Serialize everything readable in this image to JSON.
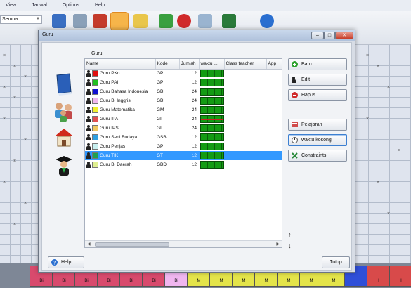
{
  "app": {
    "menu": [
      "View",
      "Jadwal",
      "Options",
      "Help"
    ],
    "filter_value": "Semua",
    "toolbar_icons": [
      "book-icon",
      "people-icon",
      "house-icon",
      "teacher-icon",
      "folder-icon",
      "save-icon",
      "stop-icon",
      "key-icon",
      "board-icon",
      "help-icon"
    ]
  },
  "bottom_blocks": [
    {
      "label": "Bi",
      "color": "#d84a6d"
    },
    {
      "label": "Bi",
      "color": "#d84a6d"
    },
    {
      "label": "Bi",
      "color": "#d84a6d"
    },
    {
      "label": "Bi",
      "color": "#d84a6d"
    },
    {
      "label": "Bi",
      "color": "#d84a6d"
    },
    {
      "label": "Bi",
      "color": "#d84a6d"
    },
    {
      "label": "Bi",
      "color": "#f0b6f0"
    },
    {
      "label": "M",
      "color": "#e4e44a"
    },
    {
      "label": "M",
      "color": "#e4e44a"
    },
    {
      "label": "M",
      "color": "#e4e44a"
    },
    {
      "label": "M",
      "color": "#e4e44a"
    },
    {
      "label": "M",
      "color": "#e4e44a"
    },
    {
      "label": "M",
      "color": "#e4e44a"
    },
    {
      "label": "M",
      "color": "#e4e44a"
    },
    {
      "label": "",
      "color": "#2f4fd8"
    },
    {
      "label": "I",
      "color": "#d84a4a"
    },
    {
      "label": "I",
      "color": "#d84a4a"
    }
  ],
  "dialog": {
    "title": "Guru",
    "list_label": "Guru",
    "columns": [
      "Name",
      "Kode",
      "Jumlah",
      "waktu ...",
      "Class teacher",
      "App"
    ],
    "rows": [
      {
        "name": "Guru PKn",
        "kode": "GP",
        "jumlah": "12",
        "color": "#e01010",
        "red_mark": false,
        "selected": false
      },
      {
        "name": "Guru PAI",
        "kode": "GP",
        "jumlah": "12",
        "color": "#22c022",
        "red_mark": false,
        "selected": false
      },
      {
        "name": "Guru Bahasa Indonesia",
        "kode": "GBI",
        "jumlah": "24",
        "color": "#1010d0",
        "red_mark": false,
        "selected": false
      },
      {
        "name": "Guru B. Inggris",
        "kode": "GBI",
        "jumlah": "24",
        "color": "#f0b8f0",
        "red_mark": false,
        "selected": false
      },
      {
        "name": "Guru Matematika",
        "kode": "GM",
        "jumlah": "24",
        "color": "#f0f030",
        "red_mark": false,
        "selected": false
      },
      {
        "name": "Guru IPA",
        "kode": "GI",
        "jumlah": "24",
        "color": "#e05050",
        "red_mark": true,
        "selected": false
      },
      {
        "name": "Guru IPS",
        "kode": "GI",
        "jumlah": "24",
        "color": "#f0c860",
        "red_mark": false,
        "selected": false
      },
      {
        "name": "Guru Seni Budaya",
        "kode": "GSB",
        "jumlah": "12",
        "color": "#30a0e0",
        "red_mark": false,
        "selected": false
      },
      {
        "name": "Guru Penjas",
        "kode": "GP",
        "jumlah": "12",
        "color": "#c8f0f0",
        "red_mark": false,
        "selected": false
      },
      {
        "name": "Guru TIK",
        "kode": "GT",
        "jumlah": "12",
        "color": "#20a050",
        "red_mark": false,
        "selected": true
      },
      {
        "name": "Guru B. Daerah",
        "kode": "GBD",
        "jumlah": "12",
        "color": "#e0f090",
        "red_mark": false,
        "selected": false
      }
    ],
    "buttons": {
      "baru": "Baru",
      "edit": "Edit",
      "hapus": "Hapus",
      "pelajaran": "Pelajaran",
      "waktu_kosong": "waktu kosong",
      "constraints": "Constraints",
      "help": "Help",
      "tutup": "Tutup"
    }
  }
}
